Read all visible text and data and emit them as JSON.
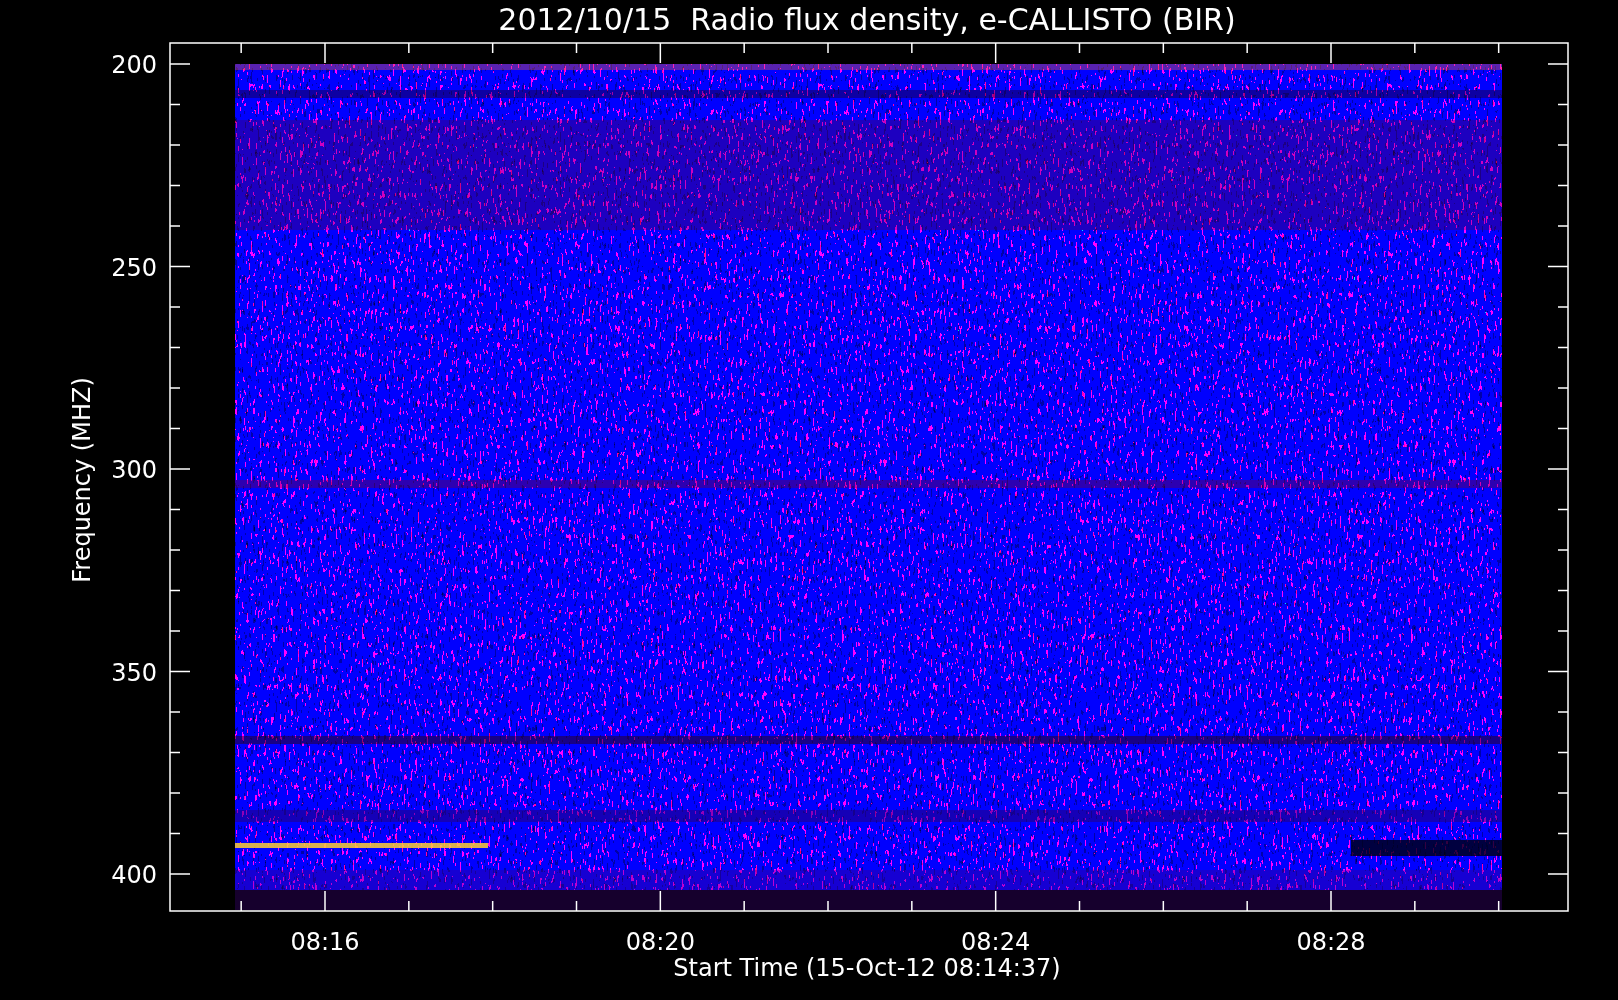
{
  "plot": {
    "title": "2012/10/15  Radio flux density, e-CALLISTO (BIR)",
    "ylabel": "Frequency (MHZ)",
    "xlabel": "Start Time (15-Oct-12 08:14:37)",
    "y_tick_labels": [
      "200",
      "250",
      "300",
      "350",
      "400"
    ],
    "x_tick_labels": [
      "08:16",
      "08:20",
      "08:24",
      "08:28"
    ]
  }
}
